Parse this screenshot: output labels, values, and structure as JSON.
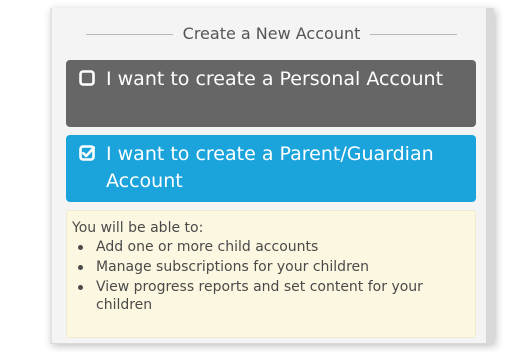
{
  "heading": "Create a New Account",
  "options": [
    {
      "label": "I want to create a Personal Account",
      "checked": false,
      "icon": "unchecked-box-icon"
    },
    {
      "label": "I want to create a Parent/Guardian Account",
      "checked": true,
      "icon": "checked-box-icon"
    }
  ],
  "info": {
    "title": "You will be able to:",
    "items": [
      "Add one or more child accounts",
      "Manage subscriptions for your children",
      "View progress reports and set content for your children"
    ]
  },
  "colors": {
    "personal_option_bg": "#666666",
    "parent_option_bg": "#1ba4dc",
    "info_bg": "#fcf7e0"
  }
}
